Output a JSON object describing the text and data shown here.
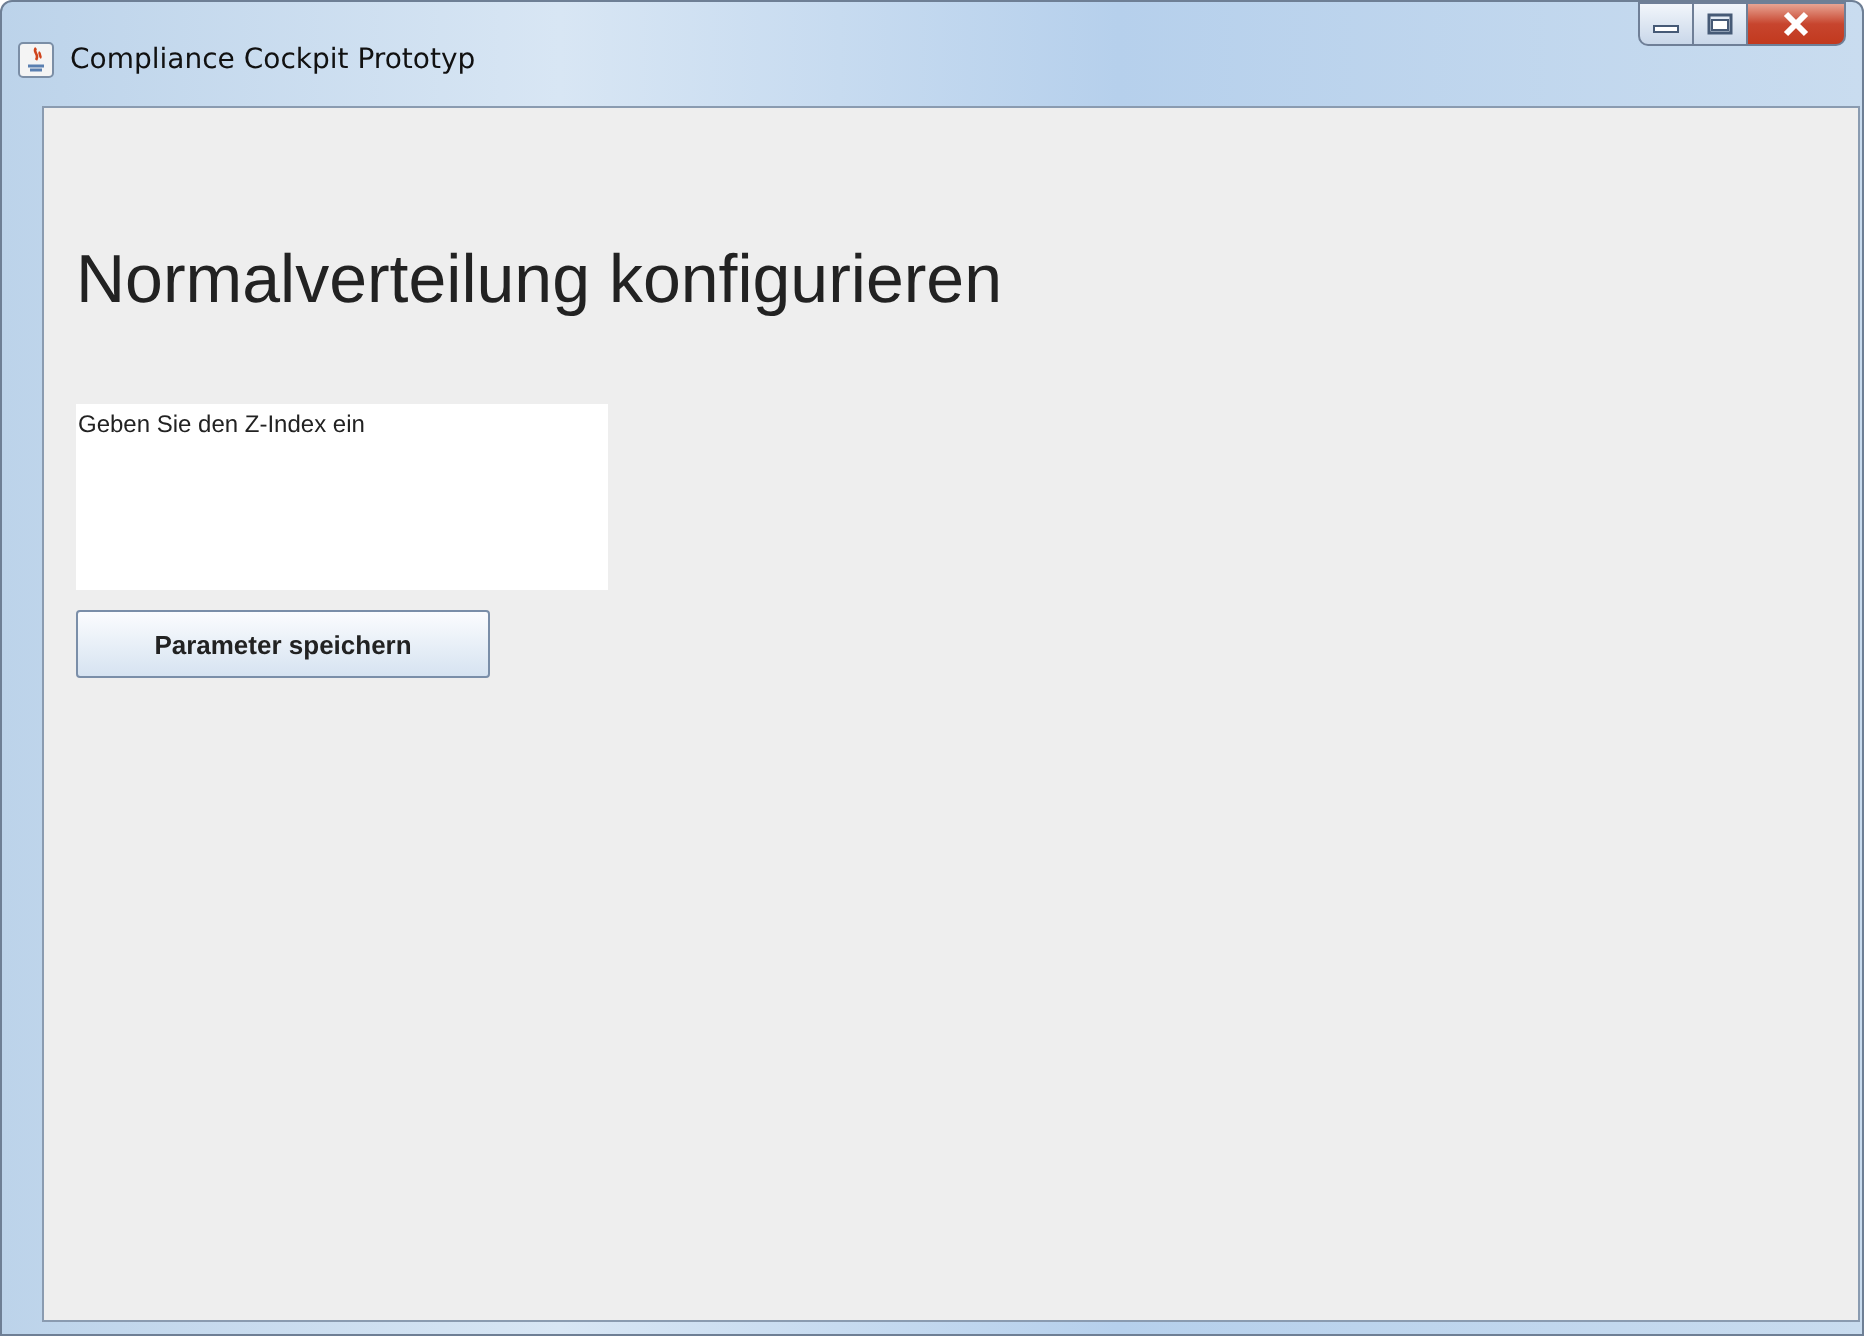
{
  "window": {
    "title": "Compliance Cockpit Prototyp"
  },
  "heading": "Normalverteilung konfigurieren",
  "text_area": {
    "value": "Geben Sie den Z-Index ein"
  },
  "buttons": [
    "Parameter speichern"
  ]
}
